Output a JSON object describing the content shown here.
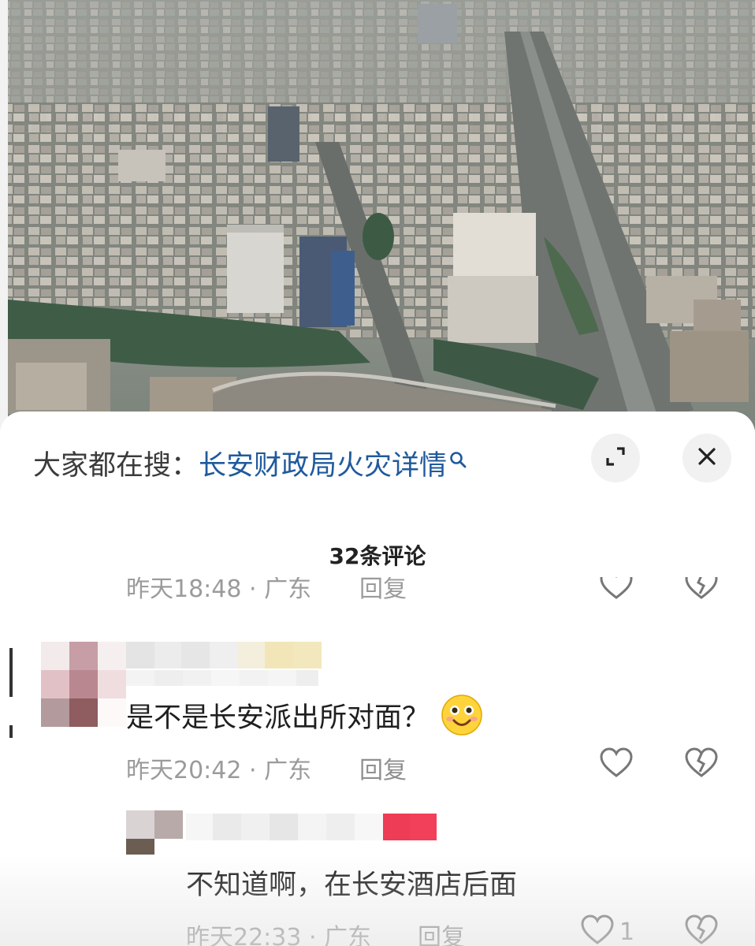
{
  "search_bar": {
    "prefix": "大家都在搜：",
    "term": "长安财政局火灾详情"
  },
  "comments_header": {
    "title": "32条评论"
  },
  "previous_comment": {
    "time_location": "昨天18:48 · 广东",
    "reply_label": "回复"
  },
  "comments": [
    {
      "text": "是不是长安派出所对面？",
      "emoji": "smiling-face-emoji",
      "time_location": "昨天20:42 · 广东",
      "reply_label": "回复"
    }
  ],
  "replies": [
    {
      "text": "不知道啊，在长安酒店后面",
      "time_location": "昨天22:33 · 广东",
      "reply_label": "回复",
      "like_count": "1"
    }
  ],
  "colors": {
    "search_term": "#1f5a9c",
    "meta_gray": "#9b9b9b",
    "sheet_bg": "#ffffff"
  },
  "icons": [
    "search-icon",
    "expand-icon",
    "close-icon",
    "heart-icon",
    "dislike-icon"
  ]
}
